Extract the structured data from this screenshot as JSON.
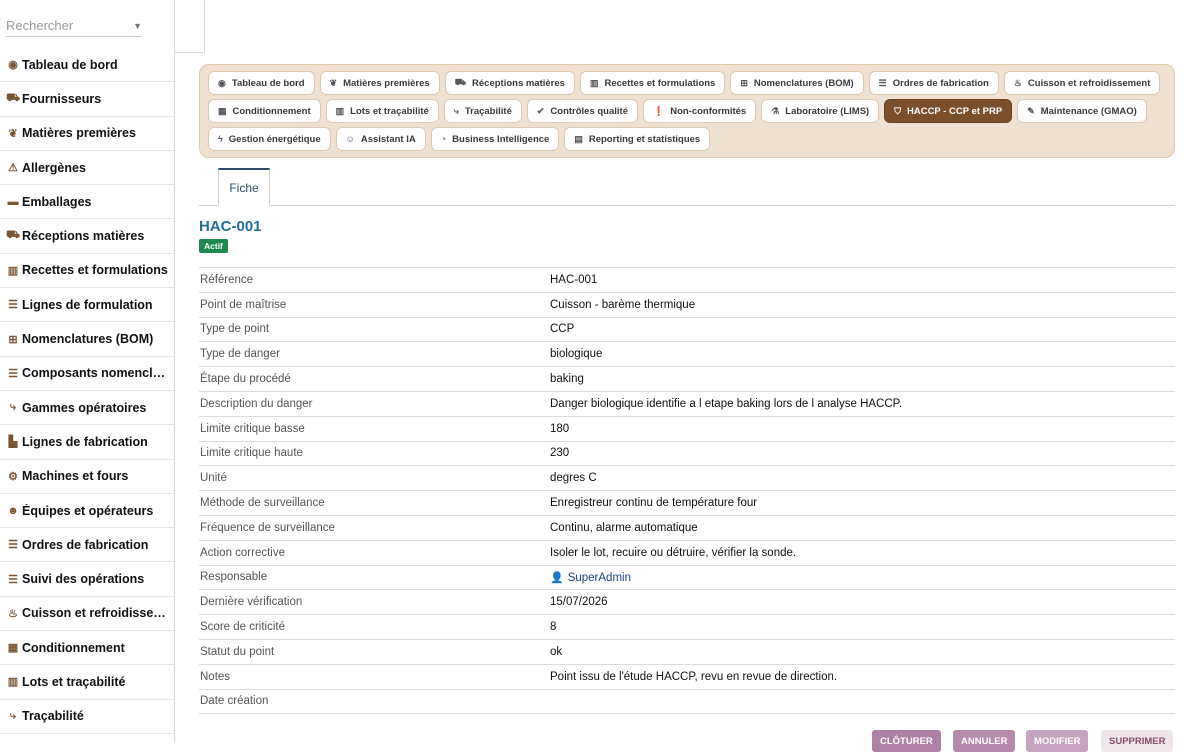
{
  "sidebar": {
    "search_placeholder": "Rechercher",
    "items": [
      {
        "label": "Tableau de bord",
        "icon": "dashboard-icon",
        "glyph": "◉"
      },
      {
        "label": "Fournisseurs",
        "icon": "truck-icon",
        "glyph": "⛟"
      },
      {
        "label": "Matières premières",
        "icon": "seedling-icon",
        "glyph": "❦"
      },
      {
        "label": "Allergènes",
        "icon": "warning-icon",
        "glyph": "⚠"
      },
      {
        "label": "Emballages",
        "icon": "box-icon",
        "glyph": "▬"
      },
      {
        "label": "Réceptions matières",
        "icon": "truck-loading-icon",
        "glyph": "⛟"
      },
      {
        "label": "Recettes et formulations",
        "icon": "book-icon",
        "glyph": "▥"
      },
      {
        "label": "Lignes de formulation",
        "icon": "list-icon",
        "glyph": "☰"
      },
      {
        "label": "Nomenclatures (BOM)",
        "icon": "sitemap-icon",
        "glyph": "⊞"
      },
      {
        "label": "Composants nomenclature",
        "icon": "list-icon",
        "glyph": "☰"
      },
      {
        "label": "Gammes opératoires",
        "icon": "route-icon",
        "glyph": "⤷"
      },
      {
        "label": "Lignes de fabrication",
        "icon": "industry-icon",
        "glyph": "▙"
      },
      {
        "label": "Machines et fours",
        "icon": "cogs-icon",
        "glyph": "⚙"
      },
      {
        "label": "Équipes et opérateurs",
        "icon": "users-icon",
        "glyph": "☻"
      },
      {
        "label": "Ordres de fabrication",
        "icon": "list-icon",
        "glyph": "☰"
      },
      {
        "label": "Suivi des opérations",
        "icon": "list-icon",
        "glyph": "☰"
      },
      {
        "label": "Cuisson et refroidissement",
        "icon": "fire-icon",
        "glyph": "♨"
      },
      {
        "label": "Conditionnement",
        "icon": "boxes-icon",
        "glyph": "▦"
      },
      {
        "label": "Lots et traçabilité",
        "icon": "barcode-icon",
        "glyph": "▥"
      },
      {
        "label": "Traçabilité",
        "icon": "route-icon",
        "glyph": "⤷"
      }
    ]
  },
  "menu": {
    "items": [
      {
        "label": "Tableau de bord",
        "icon": "dashboard-icon",
        "glyph": "◉",
        "active": false
      },
      {
        "label": "Matières premières",
        "icon": "seedling-icon",
        "glyph": "❦",
        "active": false
      },
      {
        "label": "Réceptions matières",
        "icon": "truck-loading-icon",
        "glyph": "⛟",
        "active": false
      },
      {
        "label": "Recettes et formulations",
        "icon": "book-icon",
        "glyph": "▥",
        "active": false
      },
      {
        "label": "Nomenclatures (BOM)",
        "icon": "sitemap-icon",
        "glyph": "⊞",
        "active": false
      },
      {
        "label": "Ordres de fabrication",
        "icon": "list-icon",
        "glyph": "☰",
        "active": false
      },
      {
        "label": "Cuisson et refroidissement",
        "icon": "fire-icon",
        "glyph": "♨",
        "active": false
      },
      {
        "label": "Conditionnement",
        "icon": "boxes-icon",
        "glyph": "▦",
        "active": false
      },
      {
        "label": "Lots et traçabilité",
        "icon": "barcode-icon",
        "glyph": "▥",
        "active": false
      },
      {
        "label": "Traçabilité",
        "icon": "route-icon",
        "glyph": "⤷",
        "active": false
      },
      {
        "label": "Contrôles qualité",
        "icon": "check-circle-icon",
        "glyph": "✔",
        "active": false
      },
      {
        "label": "Non-conformités",
        "icon": "exclamation-circle-icon",
        "glyph": "❗",
        "active": false
      },
      {
        "label": "Laboratoire (LIMS)",
        "icon": "flask-icon",
        "glyph": "⚗",
        "active": false
      },
      {
        "label": "HACCP - CCP et PRP",
        "icon": "shield-icon",
        "glyph": "⛉",
        "active": true
      },
      {
        "label": "Maintenance (GMAO)",
        "icon": "wrench-icon",
        "glyph": "✎",
        "active": false
      },
      {
        "label": "Gestion énergétique",
        "icon": "bolt-icon",
        "glyph": "ϟ",
        "active": false
      },
      {
        "label": "Assistant IA",
        "icon": "robot-icon",
        "glyph": "☺",
        "active": false
      },
      {
        "label": "Business Intelligence",
        "icon": "chart-pie-icon",
        "glyph": "◔",
        "active": false
      },
      {
        "label": "Reporting et statistiques",
        "icon": "file-icon",
        "glyph": "▤",
        "active": false
      }
    ]
  },
  "tabs": {
    "fiche": "Fiche"
  },
  "record": {
    "title": "HAC-001",
    "status_badge": "Actif",
    "fields": [
      {
        "key": "Référence",
        "value": "HAC-001"
      },
      {
        "key": "Point de maîtrise",
        "value": "Cuisson - barème thermique"
      },
      {
        "key": "Type de point",
        "value": "CCP"
      },
      {
        "key": "Type de danger",
        "value": "biologique"
      },
      {
        "key": "Étape du procédé",
        "value": "baking"
      },
      {
        "key": "Description du danger",
        "value": "Danger biologique identifie a l etape baking lors de l analyse HACCP."
      },
      {
        "key": "Limite critique basse",
        "value": "180"
      },
      {
        "key": "Limite critique haute",
        "value": "230"
      },
      {
        "key": "Unité",
        "value": "degres C"
      },
      {
        "key": "Méthode de surveillance",
        "value": "Enregistreur continu de température four"
      },
      {
        "key": "Fréquence de surveillance",
        "value": "Continu, alarme automatique"
      },
      {
        "key": "Action corrective",
        "value": "Isoler le lot, recuire ou détruire, vérifier la sonde."
      },
      {
        "key": "Responsable",
        "value": "SuperAdmin",
        "is_user": true
      },
      {
        "key": "Dernière vérification",
        "value": "15/07/2026"
      },
      {
        "key": "Score de criticité",
        "value": "8"
      },
      {
        "key": "Statut du point",
        "value": "ok"
      },
      {
        "key": "Notes",
        "value": "Point issu de l'étude HACCP, revu en revue de direction."
      },
      {
        "key": "Date création",
        "value": ""
      }
    ]
  },
  "actions": {
    "cloturer": "CLÔTURER",
    "annuler": "ANNULER",
    "modifier": "MODIFIER",
    "supprimer": "SUPPRIMER"
  },
  "colors": {
    "accent_brown": "#7b4f2a",
    "menu_panel_bg": "#f0e2d2",
    "status_green": "#1e8a52",
    "title_blue": "#1f6f95",
    "btn_cloturer": "#b07fa4",
    "btn_annuler": "#b58aaa",
    "btn_modifier": "#c7a3bf",
    "btn_supprimer": "#efe6ea"
  }
}
